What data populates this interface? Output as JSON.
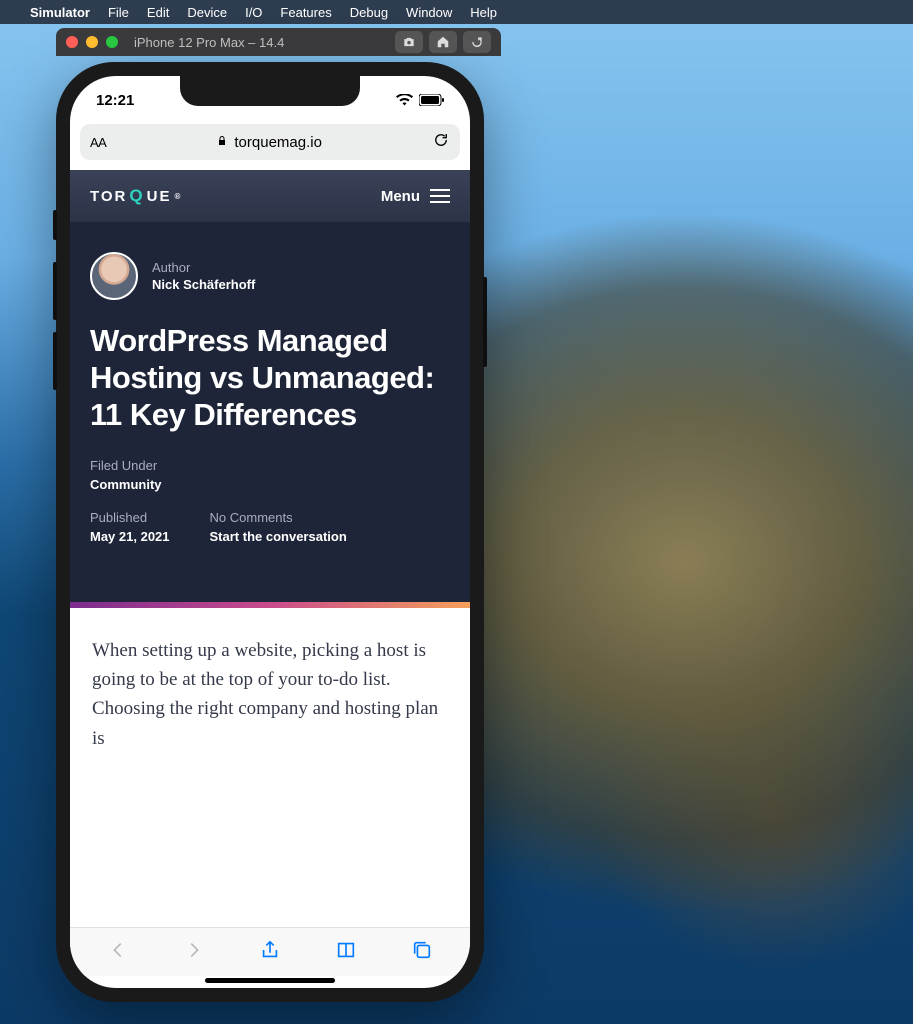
{
  "menubar": {
    "app": "Simulator",
    "items": [
      "File",
      "Edit",
      "Device",
      "I/O",
      "Features",
      "Debug",
      "Window",
      "Help"
    ]
  },
  "simWindow": {
    "title": "iPhone 12 Pro Max – 14.4"
  },
  "phone": {
    "time": "12:21",
    "url": "torquemag.io",
    "aa": "AA"
  },
  "site": {
    "logo_pre": "TOR",
    "logo_q": "Q",
    "logo_post": "UE",
    "menu": "Menu"
  },
  "article": {
    "author_label": "Author",
    "author_name": "Nick Schäferhoff",
    "title": "WordPress Managed Hosting vs Unmanaged: 11 Key Differences",
    "filed_label": "Filed Under",
    "filed_value": "Community",
    "published_label": "Published",
    "published_value": "May 21, 2021",
    "comments_label": "No Comments",
    "comments_value": "Start the conversation",
    "body": "When setting up a website, picking a host is going to be at the top of your to-do list. Choosing the right company and hosting plan is"
  }
}
